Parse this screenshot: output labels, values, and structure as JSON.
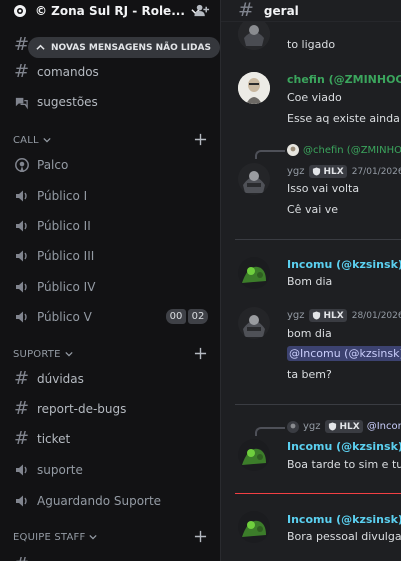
{
  "server": {
    "name": "© Zona Sul RJ - Role..."
  },
  "unread_banner": "NOVAS MENSAGENS NÃO LIDAS",
  "channels_top": [
    {
      "label": "comandos",
      "icon": "hash-icon"
    },
    {
      "label": "sugestões",
      "icon": "forum-icon"
    }
  ],
  "categories": {
    "call": "CALL",
    "suporte": "SUPORTE",
    "staff": "EQUIPE STAFF"
  },
  "call_channels": [
    {
      "label": "Palco",
      "icon": "stage-icon"
    },
    {
      "label": "Público I",
      "icon": "speaker-icon"
    },
    {
      "label": "Público II",
      "icon": "speaker-icon"
    },
    {
      "label": "Público III",
      "icon": "speaker-icon"
    },
    {
      "label": "Público IV",
      "icon": "speaker-icon"
    },
    {
      "label": "Público V",
      "icon": "speaker-icon"
    }
  ],
  "voice_counter": {
    "left": "00",
    "right": "02"
  },
  "suporte_channels": [
    {
      "label": "dúvidas",
      "icon": "hash-icon"
    },
    {
      "label": "report-de-bugs",
      "icon": "hash-icon"
    },
    {
      "label": "ticket",
      "icon": "hash-icon"
    },
    {
      "label": "suporte",
      "icon": "speaker-icon"
    },
    {
      "label": "Aguardando Suporte",
      "icon": "speaker-icon"
    }
  ],
  "chat": {
    "channel_name": "geral",
    "messages": {
      "m1_line": "to ligado",
      "m2_author": "chefin (@ZMINHOCA",
      "m2_l1": "Coe viado",
      "m2_l2": "Esse aq existe ainda",
      "m3_reply": "@chefin (@ZMINHOC",
      "m3_author": "ygz",
      "m3_tag": "HLX",
      "m3_time": "27/01/2026",
      "m3_l1": "Isso vai volta",
      "m3_l2": "Cê vai ve",
      "m4_author": "Incomu (@kzsinsk)",
      "m4_l1": "Bom dia",
      "m5_author": "ygz",
      "m5_tag": "HLX",
      "m5_time": "28/01/2026",
      "m5_l1": "bom dia",
      "m5_mention": "@Incomu (@kzsinsk)",
      "m5_l2": "ta bem?",
      "m6_reply_user": "ygz",
      "m6_reply_tag": "HLX",
      "m6_reply_mention": "@Incor",
      "m6_author": "Incomu (@kzsinsk)",
      "m6_l1": "Boa tarde to sim e tu",
      "m7_author": "Incomu (@kzsinsk)",
      "m7_l1": "Bora pessoal divulga c"
    }
  },
  "colors": {
    "author_green": "#3ba55d",
    "author_cyan": "#5bd0f0",
    "mention_bg": "#3c4270",
    "new_messages_line": "#f23f43"
  }
}
